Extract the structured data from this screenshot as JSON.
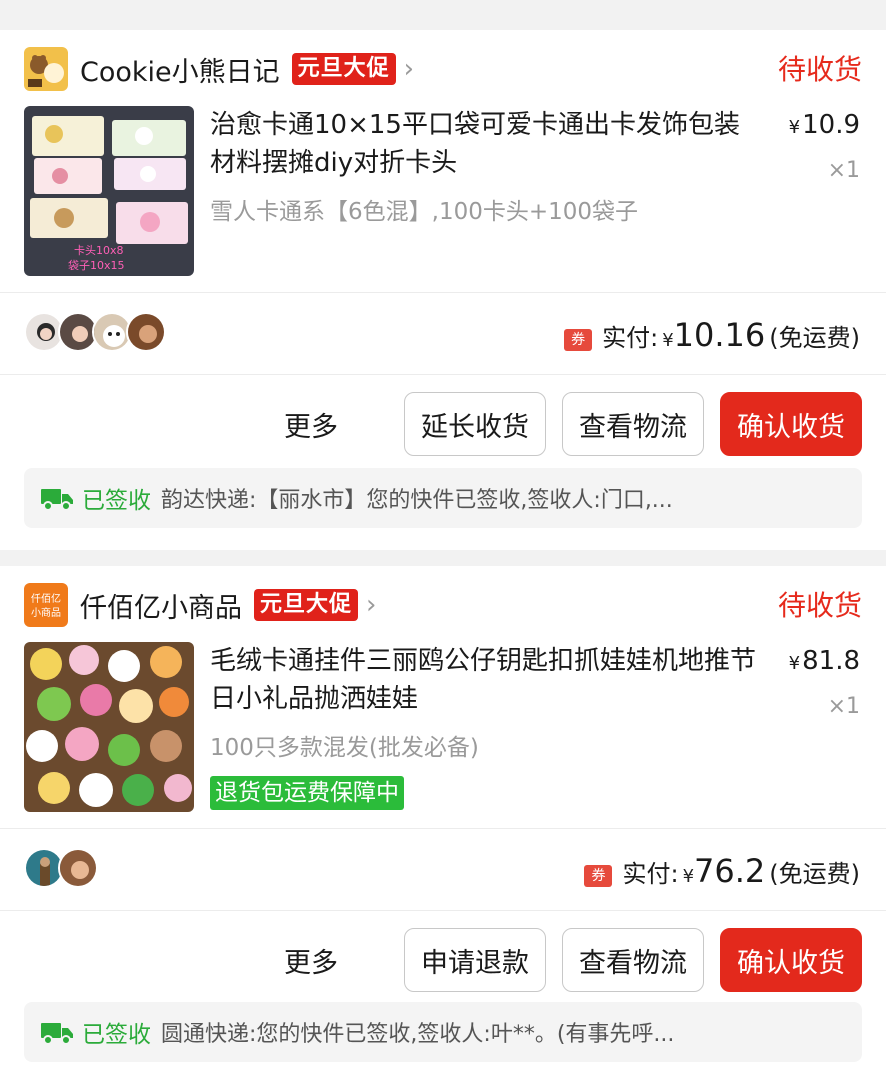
{
  "orders": [
    {
      "shop_name": "Cookie小熊日记",
      "promo_badge": "元旦大促",
      "chevron": "›",
      "status": "待收货",
      "product_title": "治愈卡通10×15平口袋可爱卡通出卡发饰包装材料摆摊diy对折卡头",
      "thumb_text_1": "卡头10x8",
      "thumb_text_2": "袋子10x15",
      "price_symbol": "¥",
      "price": "10.9",
      "quantity": "×1",
      "spec": "雪人卡通系【6色混】,100卡头+100袋子",
      "coupon_icon": "券",
      "paid_label": "实付:",
      "paid_symbol": "¥",
      "paid_amount": "10.16",
      "shipping_note": "(免运费)",
      "actions": {
        "more": "更多",
        "secondary": "延长收货",
        "logistics": "查看物流",
        "confirm": "确认收货"
      },
      "logistics_status": "已签收",
      "logistics_text": "韵达快递:【丽水市】您的快件已签收,签收人:门口,..."
    },
    {
      "shop_name": "仟佰亿小商品",
      "shop_logo_line1": "仟佰亿",
      "shop_logo_line2": "小商品",
      "promo_badge": "元旦大促",
      "chevron": "›",
      "status": "待收货",
      "product_title": "毛绒卡通挂件三丽鸥公仔钥匙扣抓娃娃机地推节日小礼品抛洒娃娃",
      "price_symbol": "¥",
      "price": "81.8",
      "quantity": "×1",
      "spec": "100只多款混发(批发必备)",
      "guarantee": "退货包运费保障中",
      "coupon_icon": "券",
      "paid_label": "实付:",
      "paid_symbol": "¥",
      "paid_amount": "76.2",
      "shipping_note": "(免运费)",
      "actions": {
        "more": "更多",
        "secondary": "申请退款",
        "logistics": "查看物流",
        "confirm": "确认收货"
      },
      "logistics_status": "已签收",
      "logistics_text": "圆通快递:您的快件已签收,签收人:叶**。(有事先呼..."
    }
  ],
  "colors": {
    "accent_red": "#e3291c",
    "status_red": "#e62a1c",
    "signed_green": "#2bab3a",
    "guarantee_green": "#2bbc3a"
  }
}
